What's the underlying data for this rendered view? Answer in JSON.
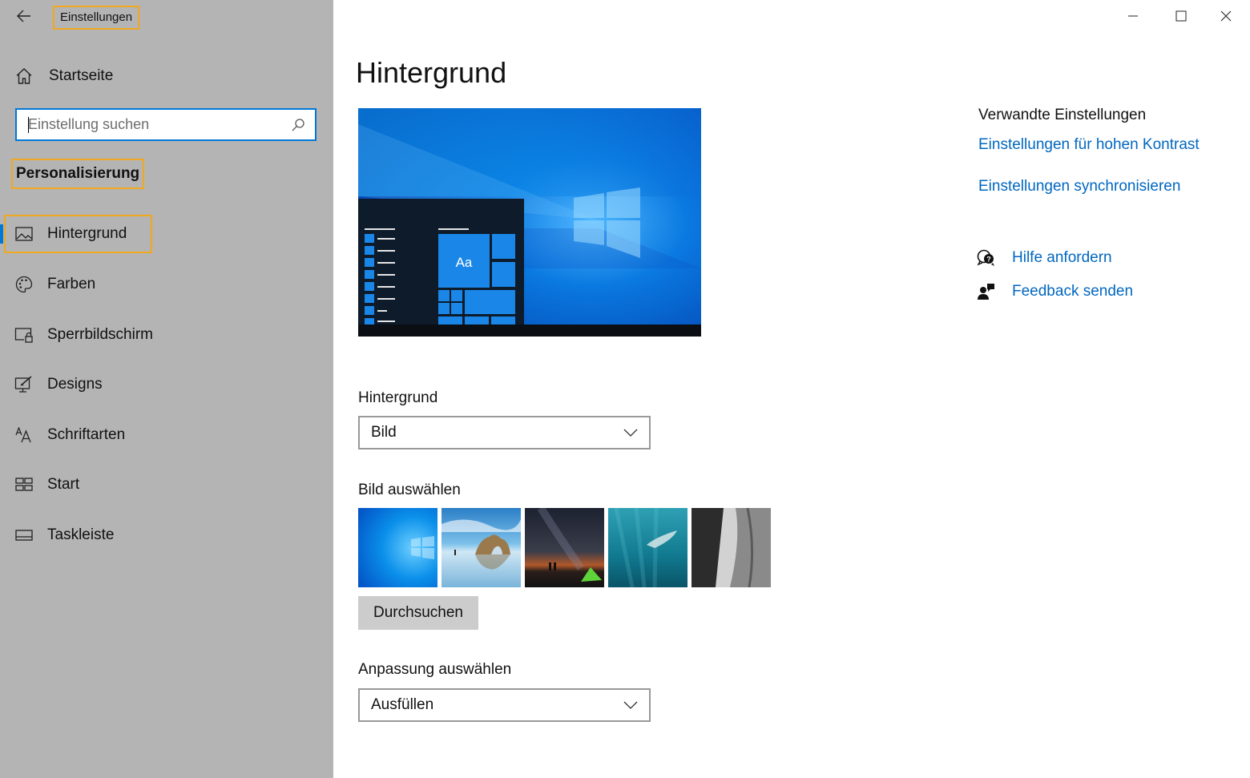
{
  "window": {
    "title": "Einstellungen",
    "controls": [
      "minimize-icon",
      "maximize-icon",
      "close-icon"
    ]
  },
  "sidebar": {
    "home_label": "Startseite",
    "search": {
      "placeholder": "Einstellung suchen",
      "value": ""
    },
    "section_heading": "Personalisierung",
    "items": [
      {
        "label": "Hintergrund",
        "icon": "picture-icon",
        "active": true
      },
      {
        "label": "Farben",
        "icon": "palette-icon",
        "active": false
      },
      {
        "label": "Sperrbildschirm",
        "icon": "lockscreen-icon",
        "active": false
      },
      {
        "label": "Designs",
        "icon": "designs-icon",
        "active": false
      },
      {
        "label": "Schriftarten",
        "icon": "fonts-icon",
        "active": false
      },
      {
        "label": "Start",
        "icon": "start-icon",
        "active": false
      },
      {
        "label": "Taskleiste",
        "icon": "taskbar-icon",
        "active": false
      }
    ]
  },
  "main": {
    "title": "Hintergrund",
    "preview_tile_text": "Aa",
    "background_label": "Hintergrund",
    "background_value": "Bild",
    "choose_picture_label": "Bild auswählen",
    "thumbnails": [
      "windows-hero",
      "beach-rock-arch",
      "night-sky-tent",
      "underwater-swimmer",
      "rock-cliff"
    ],
    "browse_label": "Durchsuchen",
    "fit_label": "Anpassung auswählen",
    "fit_value": "Ausfüllen"
  },
  "related": {
    "heading": "Verwandte Einstellungen",
    "links": [
      "Einstellungen für hohen Kontrast",
      "Einstellungen synchronisieren"
    ],
    "help_label": "Hilfe anfordern",
    "feedback_label": "Feedback senden"
  },
  "colors": {
    "accent": "#0078d7",
    "link": "#0067c0",
    "sidebar_bg": "#b4b4b4",
    "highlight_outline": "#f0a820"
  }
}
